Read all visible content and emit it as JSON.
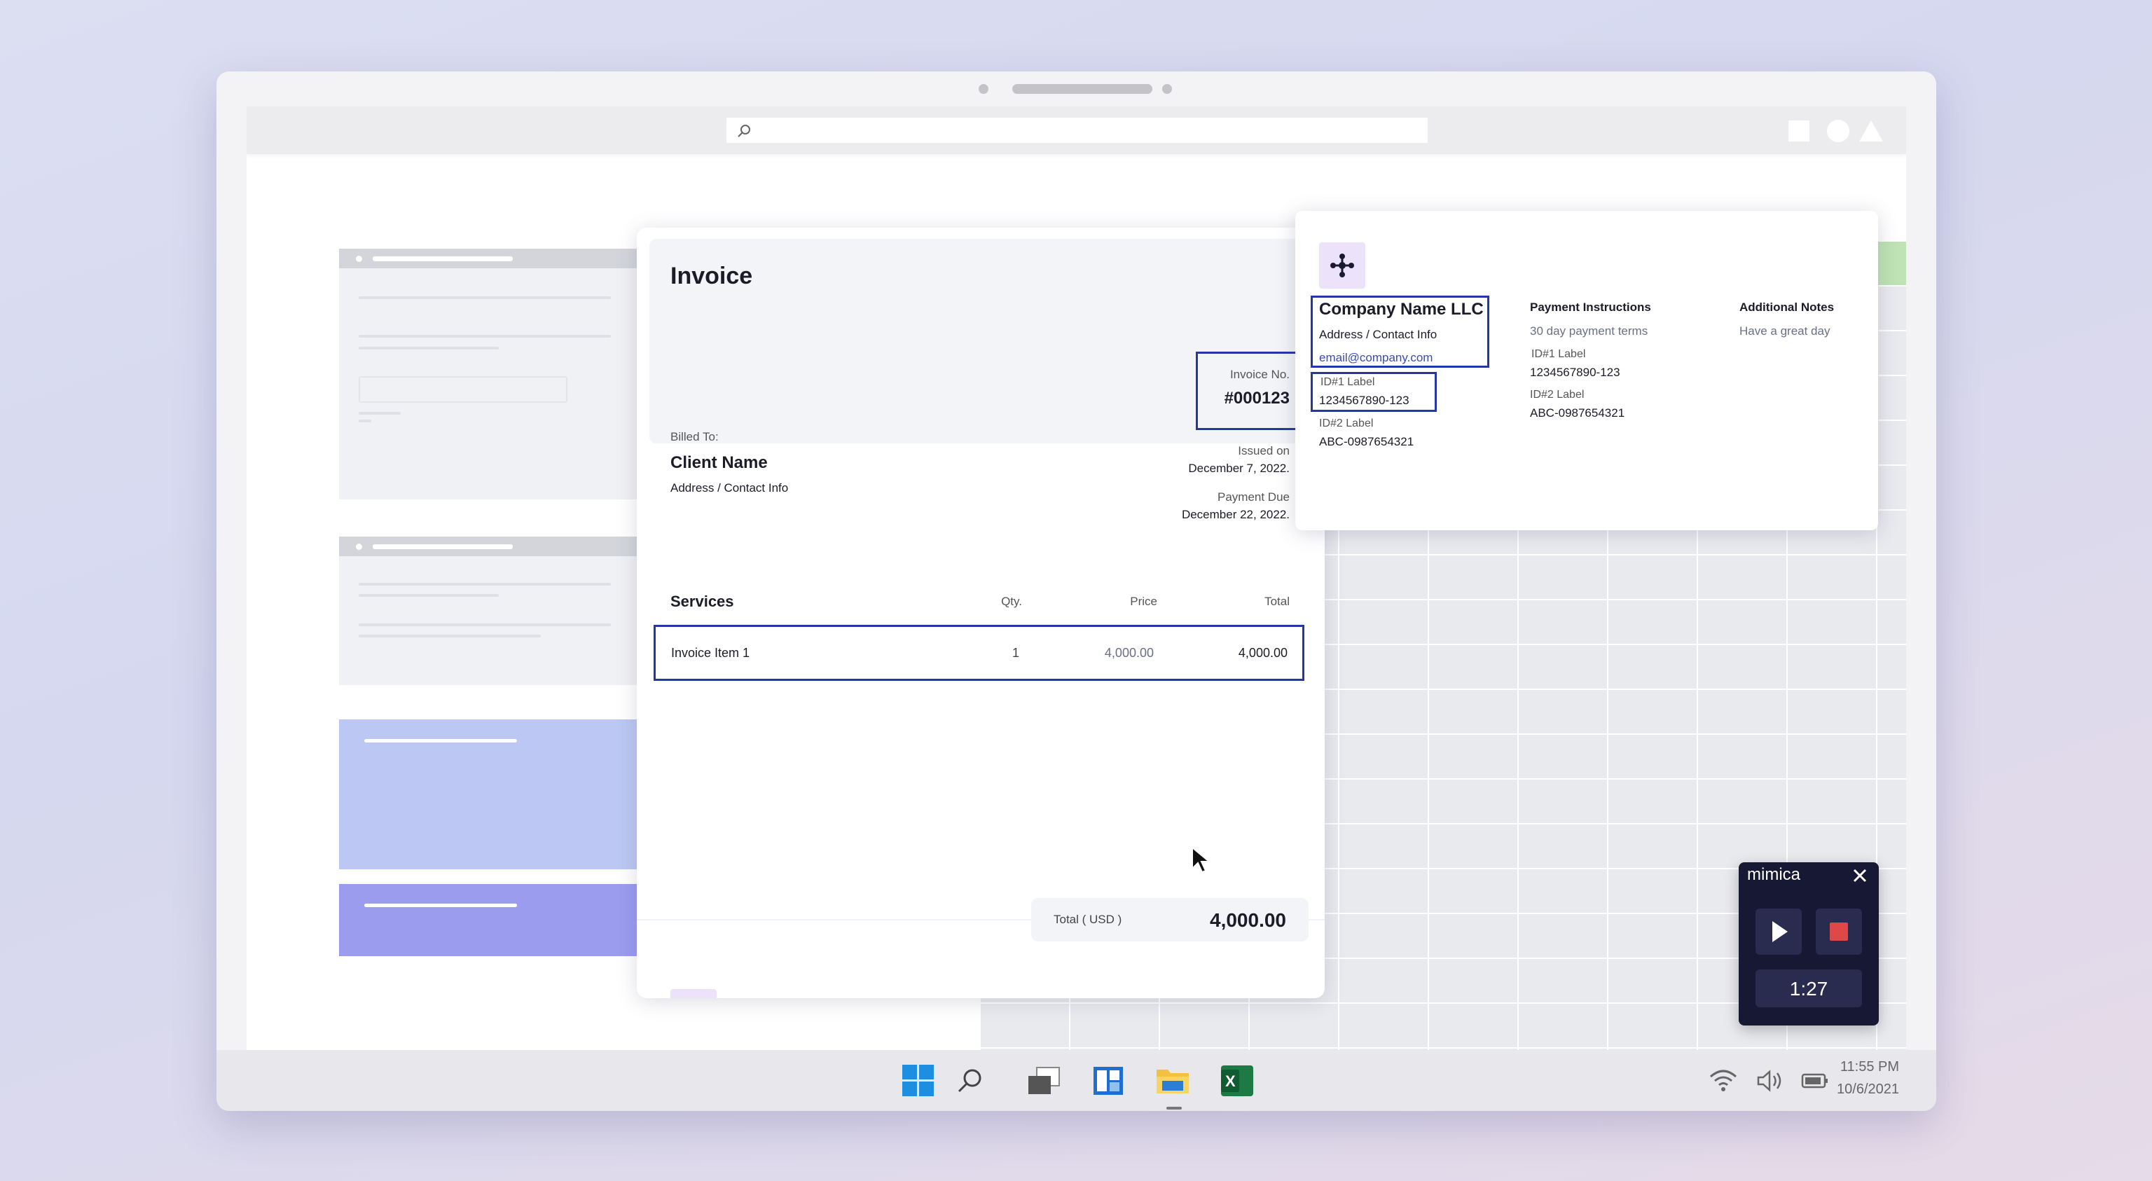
{
  "browser": {
    "search_placeholder": ""
  },
  "invoice": {
    "title": "Invoice",
    "billed_to_label": "Billed To:",
    "client_name": "Client Name",
    "client_address": "Address / Contact Info",
    "invoice_no_label": "Invoice No.",
    "invoice_no": "#000123",
    "issued_label": "Issued on",
    "issued_date": "December 7, 2022.",
    "due_label": "Payment Due",
    "due_date": "December 22, 2022.",
    "table": {
      "headers": [
        "Services",
        "Qty.",
        "Price",
        "Total"
      ],
      "rows": [
        {
          "service": "Invoice Item 1",
          "qty": "1",
          "price": "4,000.00",
          "total": "4,000.00"
        }
      ]
    },
    "total_label": "Total",
    "currency": "USD",
    "total_value": "4,000.00"
  },
  "company": {
    "name": "Company Name LLC",
    "address": "Address / Contact Info",
    "email": "email@company.com",
    "id1_label": "ID#1 Label",
    "id1_value": "1234567890-123",
    "id2_label": "ID#2 Label",
    "id2_value": "ABC-0987654321",
    "payment_heading": "Payment Instructions",
    "payment_terms": "30 day payment terms",
    "pay_id1_label": "ID#1 Label",
    "pay_id1_value": "1234567890-123",
    "pay_id2_label": "ID#2 Label",
    "pay_id2_value": "ABC-0987654321",
    "notes_heading": "Additional Notes",
    "notes_text": "Have a great day"
  },
  "mimica": {
    "title": "mimica",
    "timer": "1:27",
    "stop_color": "#e04848"
  },
  "taskbar": {
    "apps": [
      "start-icon",
      "search-icon",
      "task-view-icon",
      "widgets-icon",
      "file-explorer-icon",
      "excel-icon"
    ],
    "excel_letter": "X",
    "time": "11:55 PM",
    "date": "10/6/2021"
  },
  "colors": {
    "highlight": "#2437a8",
    "accent_purple": "#9b9cee",
    "accent_blue": "#bcc8f3",
    "grid_green": "#bfe3b4"
  }
}
